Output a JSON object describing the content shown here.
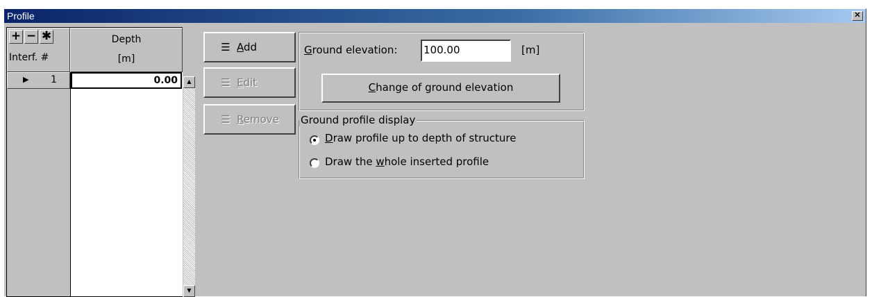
{
  "window": {
    "title": "Profile",
    "close_glyph": "✕"
  },
  "table": {
    "tools": [
      {
        "glyph": "+",
        "icon": "plus-icon"
      },
      {
        "glyph": "−",
        "icon": "minus-icon"
      },
      {
        "glyph": "✱",
        "icon": "asterisk-icon"
      }
    ],
    "row_header_label": "Interf. #",
    "col_header": "Depth",
    "col_unit": "[m]",
    "rows": [
      {
        "marker": "▶",
        "number": "1",
        "depth": "0.00"
      }
    ]
  },
  "buttons": {
    "add": {
      "icon_glyph": "☰",
      "label": "Add",
      "underline": "A",
      "rest": "dd"
    },
    "edit": {
      "icon_glyph": "☰",
      "label": "Edit",
      "underline": "E",
      "rest": "dit"
    },
    "remove": {
      "icon_glyph": "☰",
      "label": "Remove",
      "underline": "R",
      "rest": "emove"
    }
  },
  "ground": {
    "label_prefix": "",
    "label_u": "G",
    "label_rest": "round elevation:",
    "value": "100.00",
    "unit": "[m]",
    "change_btn_u": "C",
    "change_btn_rest": "hange of ground elevation"
  },
  "display": {
    "legend": "Ground profile display",
    "options": [
      {
        "u": "D",
        "rest": "raw profile up to depth of structure",
        "prefix": "",
        "checked": true
      },
      {
        "prefix": "Draw the ",
        "u": "w",
        "rest": "hole inserted profile",
        "checked": false
      }
    ]
  },
  "colors": {
    "face": "#c0c0c0",
    "title_start": "#0a246a",
    "title_end": "#a6caf0"
  }
}
